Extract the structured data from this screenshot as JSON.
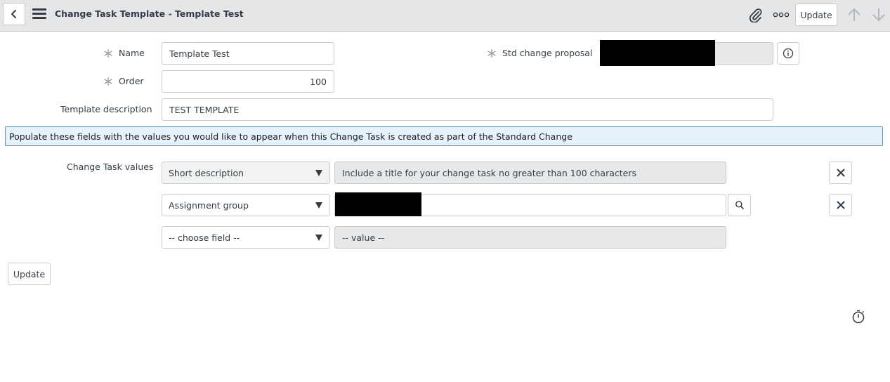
{
  "header": {
    "title": "Change Task Template - Template Test",
    "update_label": "Update",
    "icons": {
      "back": "chevron-left-icon",
      "menu": "hamburger-menu-icon",
      "attachment": "paperclip-icon",
      "more": "more-options-icon",
      "prev": "arrow-up-icon",
      "next": "arrow-down-icon"
    }
  },
  "form": {
    "name": {
      "label": "Name",
      "value": "Template Test",
      "required": true
    },
    "order": {
      "label": "Order",
      "value": "100",
      "required": true
    },
    "std_change_proposal": {
      "label": "Std change proposal",
      "value_redacted": true,
      "required": true
    },
    "template_description": {
      "label": "Template description",
      "value": "TEST TEMPLATE"
    }
  },
  "info_message": "Populate these fields with the values you would like to appear when this Change Task is created as part of the Standard Change",
  "change_task_values": {
    "label": "Change Task values",
    "rows": [
      {
        "field": "Short description",
        "value": "Include a title for your change task no greater than 100 characters"
      },
      {
        "field": "Assignment group",
        "value_redacted": true
      },
      {
        "field": "-- choose field --",
        "value": "-- value --"
      }
    ]
  },
  "footer": {
    "update_label": "Update"
  },
  "colors": {
    "header_bg": "#e4e6e7",
    "info_bg": "#e5f1fb",
    "info_border": "#4f96c4",
    "readonly_bg": "#e6e8ea",
    "text": "#343d47"
  }
}
